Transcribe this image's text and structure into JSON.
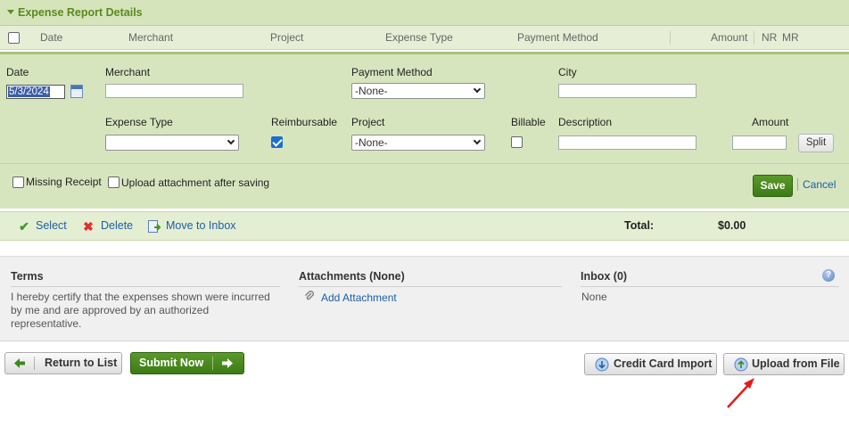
{
  "section": {
    "title": "Expense Report Details"
  },
  "columns": [
    "Date",
    "Merchant",
    "Project",
    "Expense Type",
    "Payment Method",
    "Amount",
    "NR",
    "MR"
  ],
  "form": {
    "date_label": "Date",
    "date_value": "5/3/2024",
    "merchant_label": "Merchant",
    "merchant_value": "",
    "payment_method_label": "Payment Method",
    "payment_method_value": "-None-",
    "city_label": "City",
    "city_value": "",
    "expense_type_label": "Expense Type",
    "expense_type_value": "",
    "reimbursable_label": "Reimbursable",
    "reimbursable_checked": true,
    "project_label": "Project",
    "project_value": "-None-",
    "billable_label": "Billable",
    "billable_checked": false,
    "description_label": "Description",
    "description_value": "",
    "amount_label": "Amount",
    "amount_value": "",
    "split_label": "Split",
    "missing_receipt_label": "Missing Receipt",
    "upload_after_saving_label": "Upload attachment after saving",
    "save_label": "Save",
    "cancel_label": "Cancel"
  },
  "actions": {
    "select_label": "Select",
    "delete_label": "Delete",
    "move_to_inbox_label": "Move to Inbox",
    "total_label": "Total:",
    "total_value": "$0.00"
  },
  "terms": {
    "title": "Terms",
    "text": "I hereby certify that the expenses shown were incurred by me and are approved by an authorized representative."
  },
  "attachments": {
    "title": "Attachments (None)",
    "add_label": "Add Attachment"
  },
  "inbox": {
    "title": "Inbox (0)",
    "value": "None"
  },
  "footer": {
    "return_label": "Return to List",
    "submit_label": "Submit Now",
    "cc_import_label": "Credit Card Import",
    "upload_label": "Upload from File"
  },
  "colors": {
    "accent_green": "#5a8a1e",
    "link_blue": "#1b5fa8",
    "annotation_red": "#e31b1b"
  }
}
